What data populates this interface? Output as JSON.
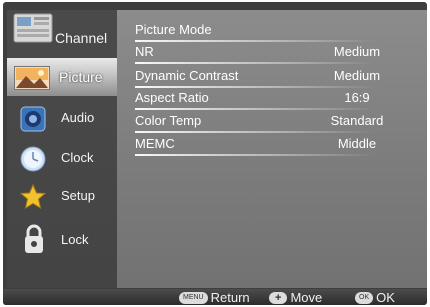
{
  "sidebar": {
    "items": [
      {
        "label": "Channel",
        "icon": "channel-grid-icon",
        "selected": false
      },
      {
        "label": "Picture",
        "icon": "picture-landscape-icon",
        "selected": true
      },
      {
        "label": "Audio",
        "icon": "audio-speaker-icon",
        "selected": false
      },
      {
        "label": "Clock",
        "icon": "clock-icon",
        "selected": false
      },
      {
        "label": "Setup",
        "icon": "setup-star-icon",
        "selected": false
      },
      {
        "label": "Lock",
        "icon": "lock-icon",
        "selected": false
      }
    ]
  },
  "main": {
    "items": [
      {
        "name": "Picture Mode",
        "value": ""
      },
      {
        "name": "NR",
        "value": "Medium"
      },
      {
        "name": "Dynamic Contrast",
        "value": "Medium"
      },
      {
        "name": "Aspect Ratio",
        "value": "16:9"
      },
      {
        "name": "Color Temp",
        "value": "Standard"
      },
      {
        "name": "MEMC",
        "value": "Middle"
      }
    ]
  },
  "footer": {
    "return_key": "MENU",
    "return_label": "Return",
    "move_key": "+",
    "move_label": "Move",
    "ok_key": "OK",
    "ok_label": "OK"
  }
}
